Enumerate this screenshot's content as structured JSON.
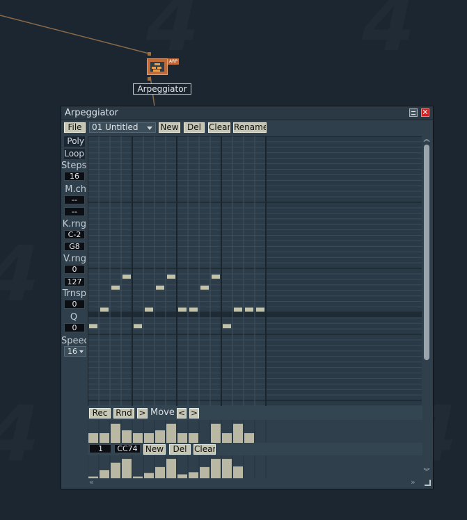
{
  "node": {
    "badge": "ARP",
    "label": "Arpeggiator"
  },
  "window": {
    "title": "Arpeggiator",
    "close_glyph": "✕"
  },
  "toolbar": {
    "file": "File",
    "preset": "01 Untitled",
    "new": "New",
    "del": "Del",
    "clear": "Clear",
    "rename": "Rename"
  },
  "sidebar": {
    "poly": "Poly",
    "loop": "Loop",
    "steps_label": "Steps",
    "steps_value": "16",
    "mch_label": "M.ch",
    "mch_value1": "--",
    "mch_value2": "--",
    "krng_label": "K.rng",
    "krng_low": "C-2",
    "krng_high": "G8",
    "vrng_label": "V.rng",
    "vrng_low": "0",
    "vrng_high": "127",
    "trnsp_label": "Trnsp",
    "trnsp_value": "0",
    "q_label": "Q",
    "q_value": "0",
    "speed_label": "Speed",
    "speed_value": "16"
  },
  "pattern_toolbar": {
    "rec": "Rec",
    "rnd": "Rnd",
    "play_glyph": ">",
    "move_label": "Move",
    "move_left": "<",
    "move_right": ">"
  },
  "cc_toolbar": {
    "channel": "1",
    "controller": "CC74",
    "new": "New",
    "del": "Del",
    "clear": "Clear"
  },
  "pattern": {
    "steps": 16,
    "rows": 49,
    "notes": [
      {
        "step": 0,
        "row": 35
      },
      {
        "step": 1,
        "row": 32
      },
      {
        "step": 2,
        "row": 28
      },
      {
        "step": 3,
        "row": 26
      },
      {
        "step": 4,
        "row": 35
      },
      {
        "step": 5,
        "row": 32
      },
      {
        "step": 6,
        "row": 28
      },
      {
        "step": 7,
        "row": 26
      },
      {
        "step": 8,
        "row": 32
      },
      {
        "step": 9,
        "row": 32
      },
      {
        "step": 10,
        "row": 28
      },
      {
        "step": 11,
        "row": 26
      },
      {
        "step": 12,
        "row": 35
      },
      {
        "step": 13,
        "row": 32
      },
      {
        "step": 14,
        "row": 32
      },
      {
        "step": 15,
        "row": 32
      }
    ]
  },
  "velocity": [
    0.45,
    0.45,
    0.88,
    0.58,
    0.45,
    0.45,
    0.58,
    0.88,
    0.45,
    0.45,
    0.0,
    0.88,
    0.45,
    0.88,
    0.45,
    0.0
  ],
  "cc_values": [
    0.08,
    0.38,
    0.72,
    0.9,
    0.08,
    0.25,
    0.52,
    0.9,
    0.18,
    0.28,
    0.52,
    0.9,
    0.9,
    0.55,
    0.0,
    0.0
  ]
}
